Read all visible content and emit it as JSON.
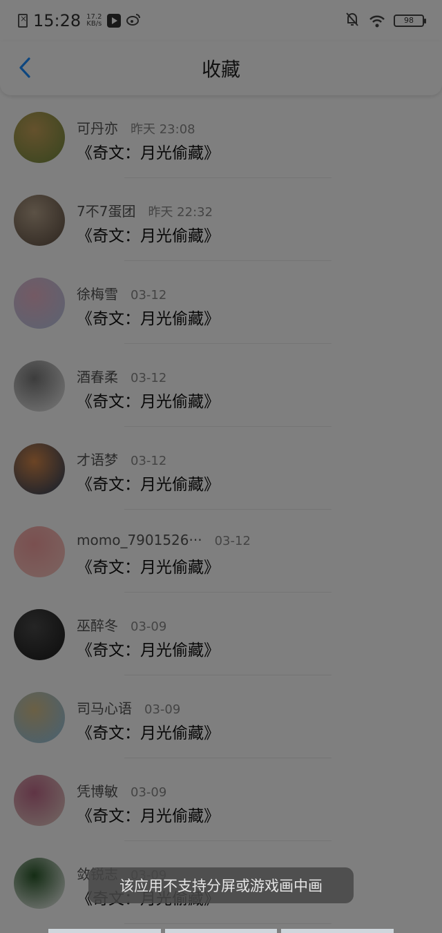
{
  "status_bar": {
    "time": "15:28",
    "net_speed_value": "17.2",
    "net_speed_unit": "KB/s",
    "battery": "98"
  },
  "nav": {
    "title": "收藏"
  },
  "list": [
    {
      "name": "可丹亦",
      "time": "昨天 23:08",
      "title": "《奇文：月光偷藏》",
      "avatar_colors": [
        "#6e8a3e",
        "#c9a35a"
      ]
    },
    {
      "name": "7不7蛋团",
      "time": "昨天 22:32",
      "title": "《奇文：月光偷藏》",
      "avatar_colors": [
        "#5a4a3e",
        "#b8a48c"
      ]
    },
    {
      "name": "徐梅雪",
      "time": "03-12",
      "title": "《奇文：月光偷藏》",
      "avatar_colors": [
        "#b6c8e6",
        "#e8b4c8"
      ]
    },
    {
      "name": "酒春柔",
      "time": "03-12",
      "title": "《奇文：月光偷藏》",
      "avatar_colors": [
        "#f2f2f2",
        "#7a7a7a"
      ]
    },
    {
      "name": "才语梦",
      "time": "03-12",
      "title": "《奇文：月光偷藏》",
      "avatar_colors": [
        "#233a5a",
        "#d8894a"
      ]
    },
    {
      "name": "momo_7901526···",
      "time": "03-12",
      "title": "《奇文：月光偷藏》",
      "avatar_colors": [
        "#f8c9c2",
        "#f4a0a0"
      ]
    },
    {
      "name": "巫醉冬",
      "time": "03-09",
      "title": "《奇文：月光偷藏》",
      "avatar_colors": [
        "#1a1a1a",
        "#4a4a4a"
      ]
    },
    {
      "name": "司马心语",
      "time": "03-09",
      "title": "《奇文：月光偷藏》",
      "avatar_colors": [
        "#8ec2e8",
        "#d6c18a"
      ]
    },
    {
      "name": "凭博敏",
      "time": "03-09",
      "title": "《奇文：月光偷藏》",
      "avatar_colors": [
        "#e6d2c8",
        "#c06a8a"
      ]
    },
    {
      "name": "敛锐志",
      "time": "03-09",
      "title": "《奇文：月光偷藏》",
      "avatar_colors": [
        "#ffffff",
        "#2a5a2a"
      ]
    }
  ],
  "toast": {
    "text": "该应用不支持分屏或游戏画中画"
  },
  "colors": {
    "accent": "#1a8cff",
    "overlay": "rgba(0,0,0,0.5)"
  }
}
